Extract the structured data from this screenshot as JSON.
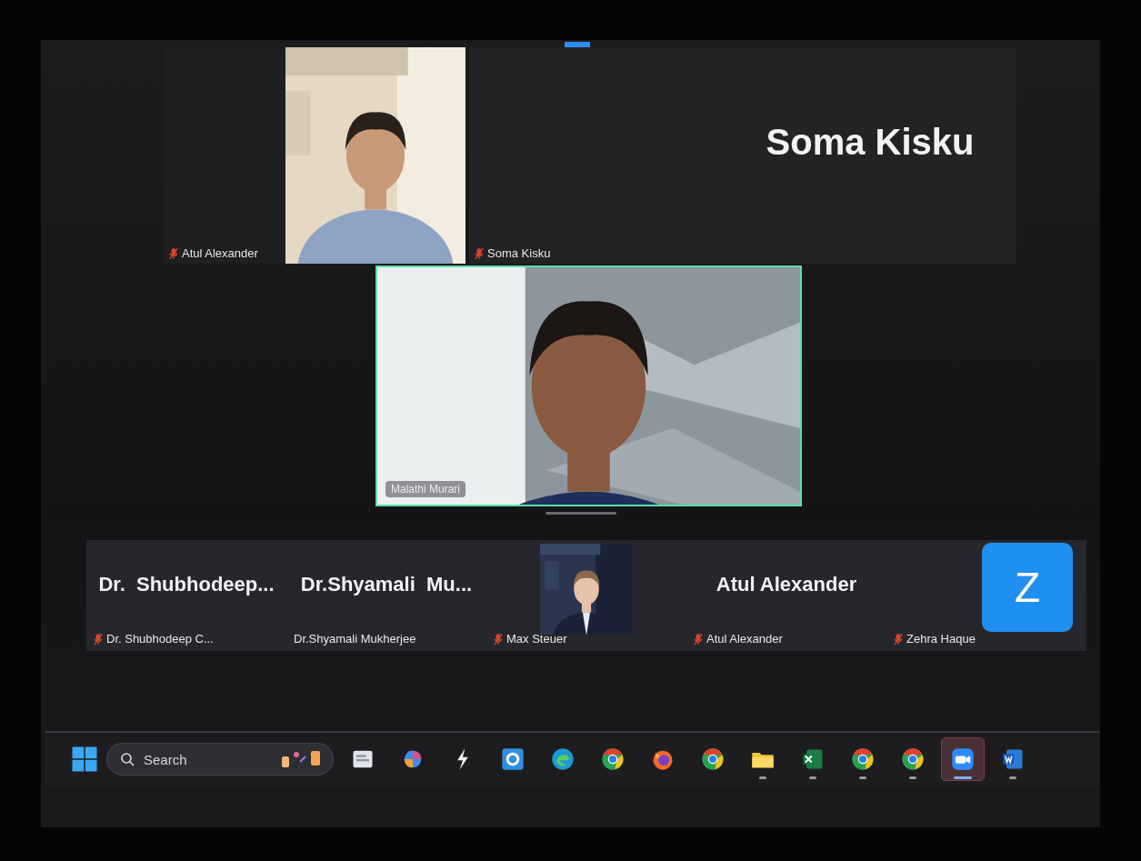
{
  "top_tiles": [
    {
      "kind": "video",
      "name": "Atul Alexander",
      "muted": true
    },
    {
      "kind": "name",
      "display_name": "Soma Kisku",
      "name": "Soma Kisku",
      "muted": true
    }
  ],
  "speaker": {
    "kind": "video",
    "name": "Malathi Murari",
    "active": true
  },
  "gallery": [
    {
      "kind": "name",
      "display_name": "Dr.  Shubhodeep...",
      "name": "Dr. Shubhodeep C...",
      "muted": true
    },
    {
      "kind": "name",
      "display_name": "Dr.Shyamali  Mu...",
      "name": "Dr.Shyamali Mukherjee",
      "muted": false
    },
    {
      "kind": "video",
      "name": "Max Steuer",
      "muted": true
    },
    {
      "kind": "name",
      "display_name": "Atul Alexander",
      "name": "Atul Alexander",
      "muted": true
    },
    {
      "kind": "avatar",
      "initial": "Z",
      "name": "Zehra Haque",
      "muted": true
    }
  ],
  "taskbar": {
    "search": {
      "placeholder": "Search"
    },
    "apps": [
      {
        "kind": "notes",
        "running": false,
        "selected": false
      },
      {
        "kind": "swirl",
        "running": false,
        "selected": false
      },
      {
        "kind": "lightning",
        "running": false,
        "selected": false
      },
      {
        "kind": "gear",
        "running": false,
        "selected": false
      },
      {
        "kind": "edge",
        "running": false,
        "selected": false
      },
      {
        "kind": "chrome",
        "running": false,
        "selected": false
      },
      {
        "kind": "fox",
        "running": false,
        "selected": false
      },
      {
        "kind": "chrome",
        "running": false,
        "selected": false
      },
      {
        "kind": "folder",
        "running": true,
        "selected": false
      },
      {
        "kind": "sheet",
        "running": true,
        "selected": false
      },
      {
        "kind": "chrome",
        "running": true,
        "selected": false
      },
      {
        "kind": "chrome",
        "running": true,
        "selected": false
      },
      {
        "kind": "camera",
        "running": true,
        "selected": true
      },
      {
        "kind": "doc",
        "running": true,
        "selected": false
      }
    ]
  }
}
